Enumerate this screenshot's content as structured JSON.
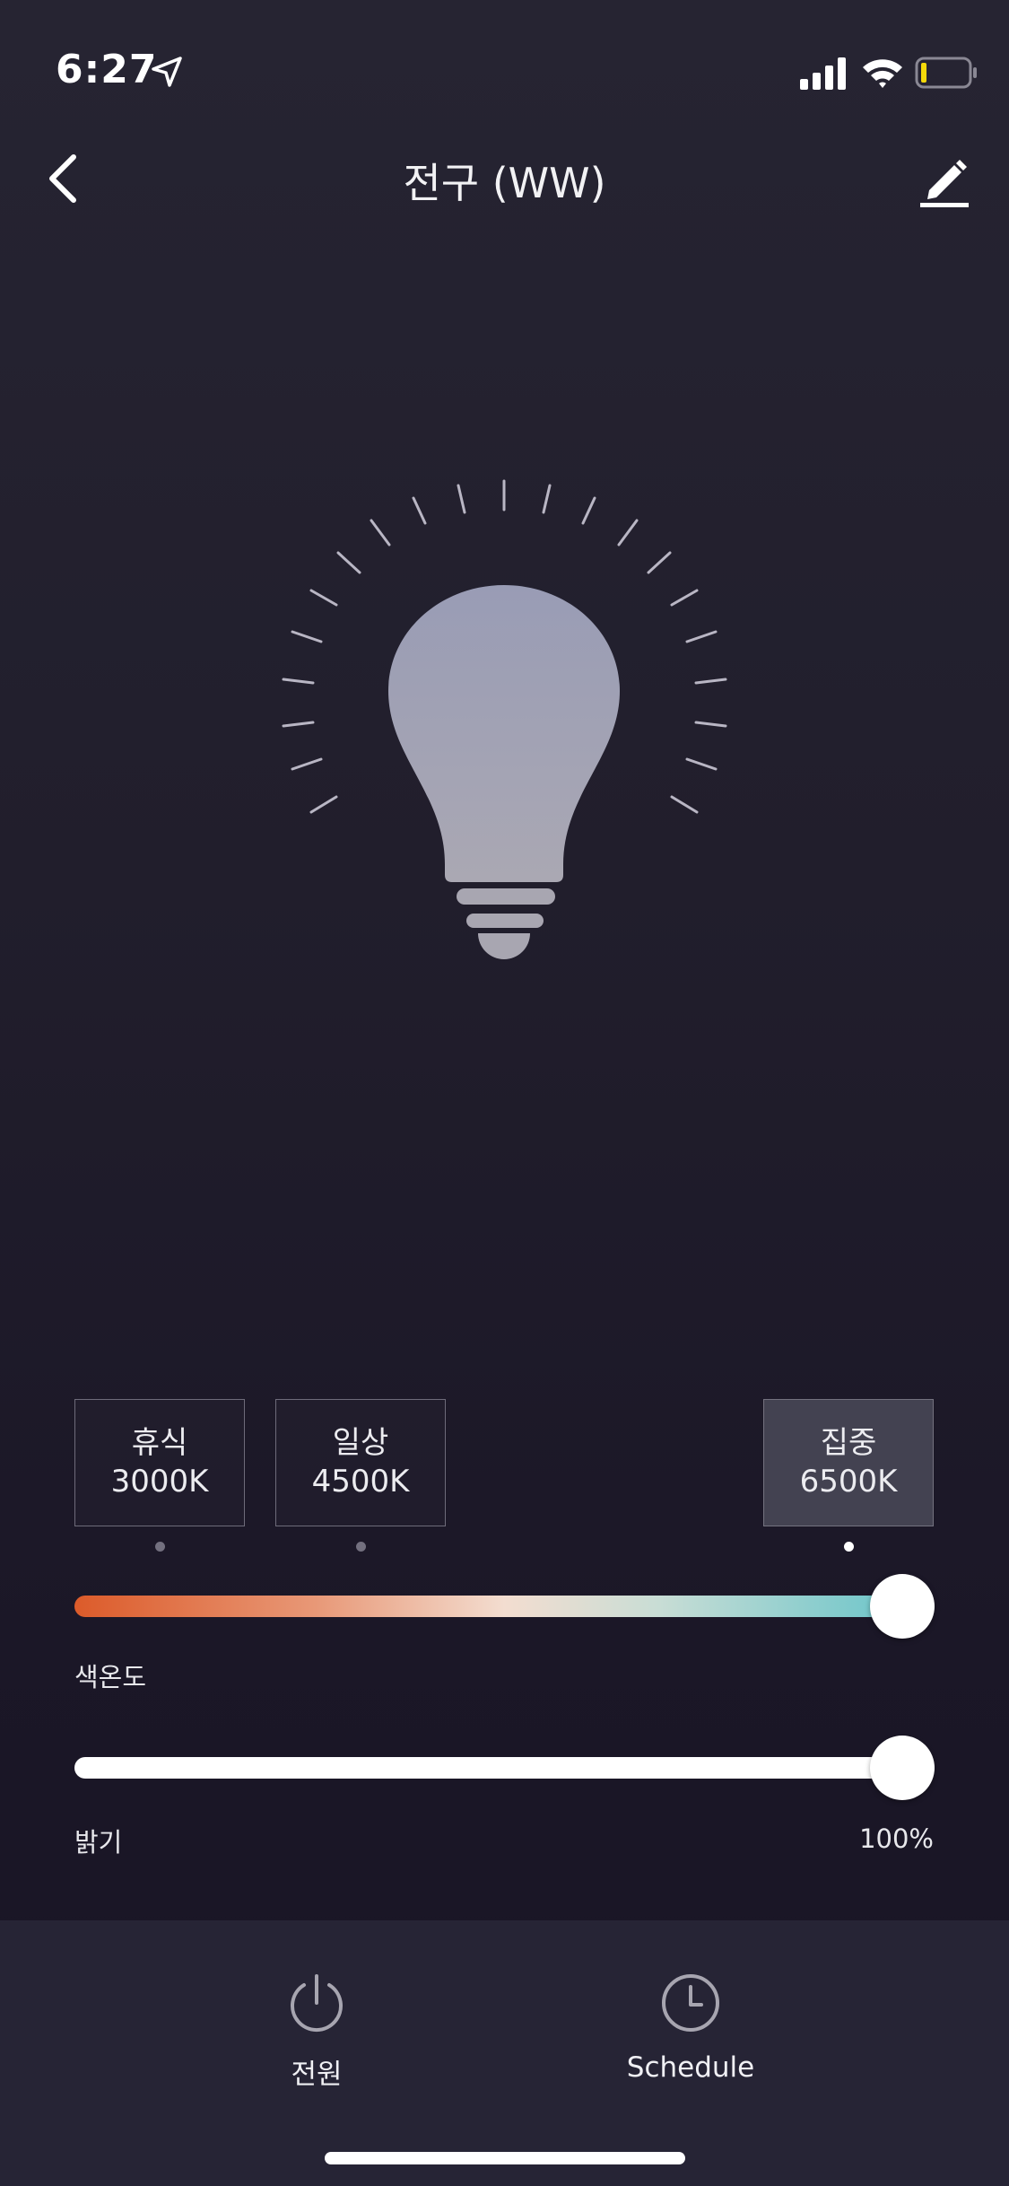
{
  "status_bar": {
    "time": "6:27"
  },
  "header": {
    "title": "전구 (WW)"
  },
  "presets": [
    {
      "name": "휴식",
      "temp": "3000K",
      "active": false
    },
    {
      "name": "일상",
      "temp": "4500K",
      "active": false
    },
    {
      "name": "집중",
      "temp": "6500K",
      "active": true
    }
  ],
  "color_temp": {
    "label": "색온도",
    "value_fraction": 1.0
  },
  "brightness": {
    "label": "밝기",
    "value": "100%"
  },
  "bottom_tabs": {
    "power_label": "전원",
    "schedule_label": "Schedule"
  },
  "colors": {
    "background": "#211e2c",
    "bottom_bar": "#262435",
    "bulb": "#9a9cb2",
    "temp_warm": "#dc5b2a",
    "temp_cool": "#5fc2c8",
    "battery_level": "#f5d90a"
  },
  "icons": [
    "location-arrow-icon",
    "cellular-signal-icon",
    "wifi-icon",
    "battery-icon",
    "back-chevron-icon",
    "edit-pencil-icon",
    "light-bulb-icon",
    "power-icon",
    "clock-icon"
  ]
}
